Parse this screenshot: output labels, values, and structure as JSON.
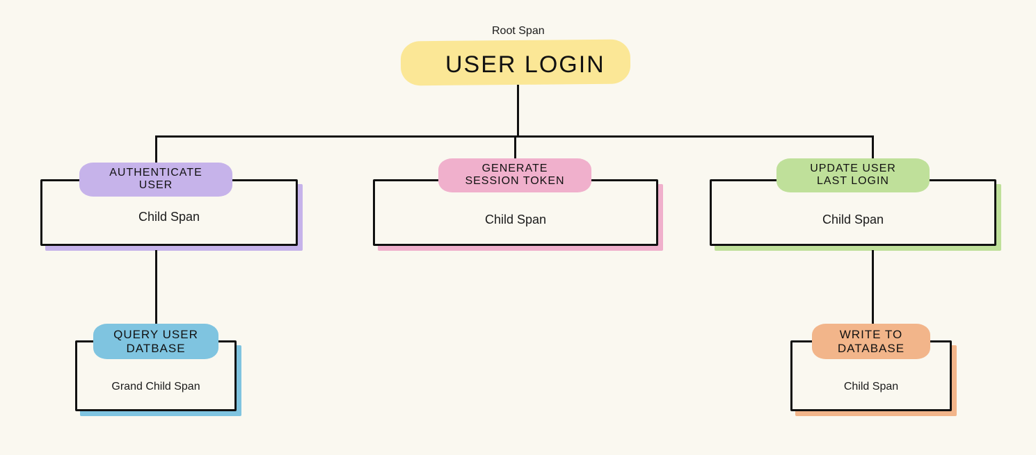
{
  "root": {
    "caption": "Root Span",
    "title": "USER LOGIN"
  },
  "children": [
    {
      "tag": "AUTHENTICATE USER",
      "body": "Child Span",
      "color": "purple",
      "child": {
        "tag": "QUERY USER DATBASE",
        "body": "Grand Child Span",
        "color": "blue"
      }
    },
    {
      "tag": "GENERATE SESSION TOKEN",
      "body": "Child Span",
      "color": "pink"
    },
    {
      "tag": "UPDATE USER LAST LOGIN",
      "body": "Child Span",
      "color": "green",
      "child": {
        "tag": "WRITE TO DATABASE",
        "body": "Child Span",
        "color": "orange"
      }
    }
  ],
  "colors": {
    "yellow": "#fbe796",
    "purple": "#c6b3ea",
    "pink": "#f0b0cc",
    "green": "#bfe09a",
    "blue": "#7fc4e0",
    "orange": "#f2b58a"
  }
}
